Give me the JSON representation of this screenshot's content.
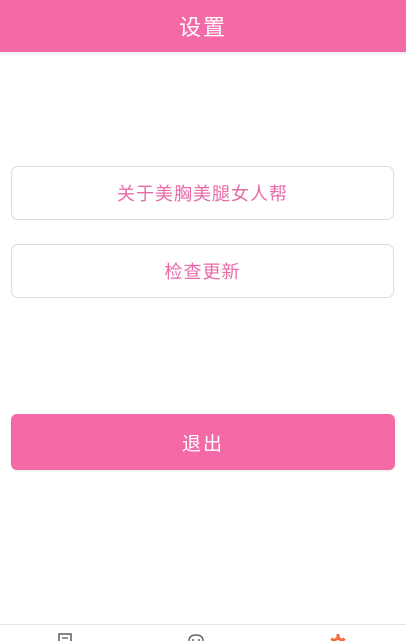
{
  "header": {
    "title": "设置"
  },
  "menu": [
    {
      "label": "关于美胸美腿女人帮"
    },
    {
      "label": "检查更新"
    }
  ],
  "logout": {
    "label": "退出"
  },
  "tabbar": {
    "tabs": [
      {
        "icon": "list-icon",
        "color": "#666666"
      },
      {
        "icon": "chat-icon",
        "color": "#666666"
      },
      {
        "icon": "settings-gear-icon",
        "color": "#f46a3e"
      }
    ]
  },
  "colors": {
    "brand": "#f46aa6",
    "menu_text": "#e86aa7",
    "active_tab": "#f46a3e"
  }
}
